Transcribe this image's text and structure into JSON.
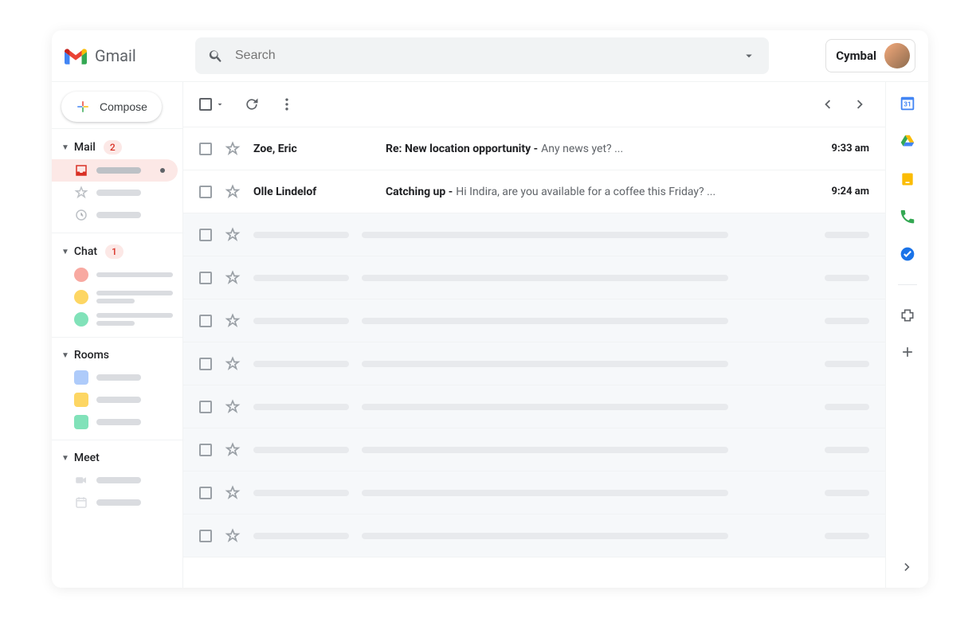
{
  "header": {
    "app_name": "Gmail",
    "search_placeholder": "Search",
    "brand": "Cymbal"
  },
  "compose_label": "Compose",
  "sections": {
    "mail": {
      "title": "Mail",
      "badge": "2"
    },
    "chat": {
      "title": "Chat",
      "badge": "1"
    },
    "rooms": {
      "title": "Rooms"
    },
    "meet": {
      "title": "Meet"
    }
  },
  "emails": [
    {
      "sender": "Zoe, Eric",
      "subject": "Re: New location opportunity - ",
      "snippet": "Any news yet? ...",
      "time": "9:33 am",
      "unread": true
    },
    {
      "sender": "Olle Lindelof",
      "subject": "Catching up - ",
      "snippet": "Hi Indira, are you available for a coffee this Friday? ...",
      "time": "9:24 am",
      "unread": true
    }
  ],
  "placeholder_rows": 8,
  "colors": {
    "chat_avatars": [
      "#f8a9a1",
      "#fdd663",
      "#81e2b9"
    ],
    "room_squares": [
      "#aecbfa",
      "#fdd663",
      "#81e2b9"
    ]
  },
  "rail_calendar_day": "31"
}
